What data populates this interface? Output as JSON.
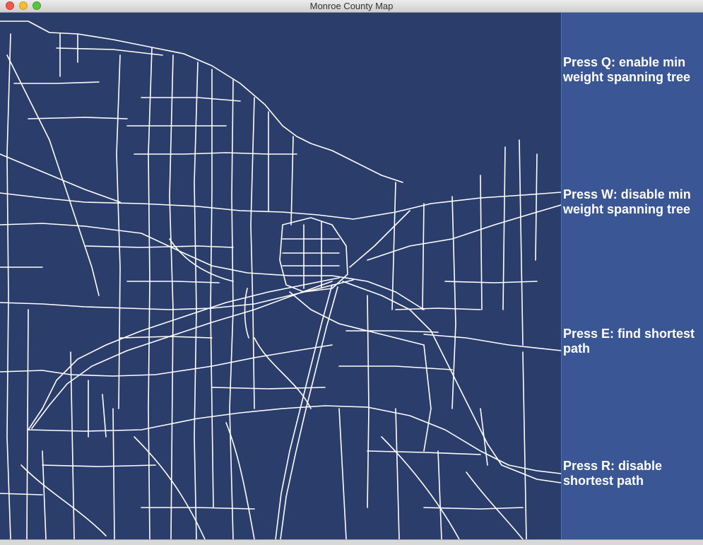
{
  "window": {
    "title": "Monroe County Map"
  },
  "colors": {
    "map_background": "#2a3d6b",
    "road": "#ffffff",
    "panel": "#3b5694",
    "text": "#ffffff"
  },
  "instructions": [
    {
      "text": "Press Q: enable min weight spanning tree"
    },
    {
      "text": "Press W: disable min weight spanning tree"
    },
    {
      "text": "Press E: find shortest path"
    },
    {
      "text": "Press R: disable shortest path"
    }
  ]
}
